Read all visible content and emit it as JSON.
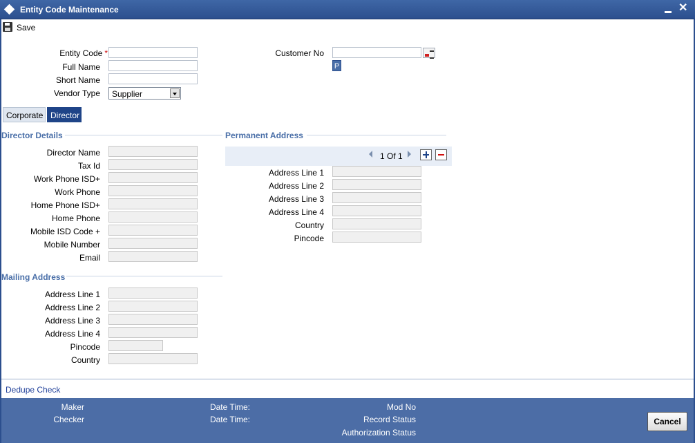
{
  "window": {
    "title": "Entity Code Maintenance"
  },
  "toolbar": {
    "save_label": "Save"
  },
  "header": {
    "entity_code_label": "Entity Code",
    "entity_code_value": "",
    "full_name_label": "Full Name",
    "full_name_value": "",
    "short_name_label": "Short Name",
    "short_name_value": "",
    "vendor_type_label": "Vendor Type",
    "vendor_type_value": "Supplier",
    "customer_no_label": "Customer No",
    "customer_no_value": "",
    "p_button_label": "P"
  },
  "tabs": [
    {
      "label": "Corporate",
      "active": false
    },
    {
      "label": "Director",
      "active": true
    }
  ],
  "director_details": {
    "title": "Director Details",
    "fields": [
      {
        "label": "Director Name",
        "value": ""
      },
      {
        "label": "Tax Id",
        "value": ""
      },
      {
        "label": "Work Phone ISD+",
        "value": ""
      },
      {
        "label": "Work Phone",
        "value": ""
      },
      {
        "label": "Home Phone ISD+",
        "value": ""
      },
      {
        "label": "Home Phone",
        "value": ""
      },
      {
        "label": "Mobile ISD Code +",
        "value": ""
      },
      {
        "label": "Mobile Number",
        "value": ""
      },
      {
        "label": "Email",
        "value": ""
      }
    ]
  },
  "mailing_address": {
    "title": "Mailing Address",
    "fields": [
      {
        "label": "Address Line 1",
        "value": ""
      },
      {
        "label": "Address Line 2",
        "value": ""
      },
      {
        "label": "Address Line 3",
        "value": ""
      },
      {
        "label": "Address Line 4",
        "value": ""
      },
      {
        "label": "Pincode",
        "value": ""
      },
      {
        "label": "Country",
        "value": ""
      }
    ]
  },
  "permanent_address": {
    "title": "Permanent Address",
    "pagination": "1 Of 1",
    "fields": [
      {
        "label": "Address Line 1",
        "value": ""
      },
      {
        "label": "Address Line 2",
        "value": ""
      },
      {
        "label": "Address Line 3",
        "value": ""
      },
      {
        "label": "Address Line 4",
        "value": ""
      },
      {
        "label": "Country",
        "value": ""
      },
      {
        "label": "Pincode",
        "value": ""
      }
    ]
  },
  "dedupe_label": "Dedupe Check",
  "footer": {
    "maker_label": "Maker",
    "checker_label": "Checker",
    "date_time_label_1": "Date Time:",
    "date_time_label_2": "Date Time:",
    "mod_no_label": "Mod No",
    "record_status_label": "Record Status",
    "authorization_status_label": "Authorization Status",
    "cancel_label": "Cancel"
  }
}
